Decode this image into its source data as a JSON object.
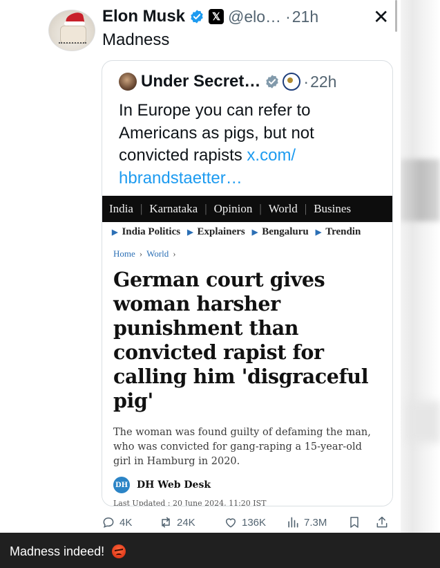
{
  "tweet": {
    "author_name": "Elon Musk",
    "handle": "@elo…",
    "time": "21h",
    "text": "Madness",
    "actions": {
      "replies": "4K",
      "reposts": "24K",
      "likes": "136K",
      "views": "7.3M"
    }
  },
  "quote": {
    "author_name": "Under Secret…",
    "time": "22h",
    "text": "In Europe you can refer to Americans as pigs, but not convicted rapists",
    "link": "x.com/ hbrandstaetter…"
  },
  "article": {
    "nav": [
      "India",
      "Karnataka",
      "Opinion",
      "World",
      "Busines"
    ],
    "subnav": [
      "India Politics",
      "Explainers",
      "Bengaluru",
      "Trendin"
    ],
    "breadcrumb": [
      "Home",
      "World"
    ],
    "headline": "German court gives woman harsher punishment than convicted rapist for calling him 'disgraceful pig'",
    "summary": "The woman was found guilty of defaming the man, who was convicted for gang-raping a 15-year-old girl in Hamburg in 2020.",
    "logo_text": "DH",
    "author": "DH Web Desk",
    "updated": "Last Updated : 20 June 2024, 11:20 IST"
  },
  "caption": {
    "text": "Madness indeed!"
  },
  "colors": {
    "verified": "#1d9bf0",
    "link": "#1d9bf0",
    "muted": "#536471",
    "nav_bg": "#0d0d0d",
    "caption_bg": "#202020"
  },
  "icons": [
    "verified-badge-icon",
    "x-logo-icon",
    "close-icon",
    "gray-verified-badge-icon",
    "state-seal-icon",
    "reply-icon",
    "repost-icon",
    "like-icon",
    "views-icon",
    "bookmark-icon",
    "share-icon",
    "angry-face-emoji"
  ]
}
